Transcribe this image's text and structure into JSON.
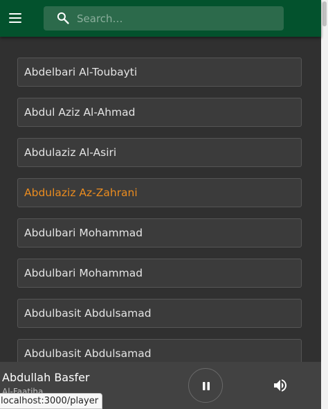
{
  "header": {
    "search": {
      "placeholder": "Search…",
      "value": ""
    }
  },
  "reciters": [
    {
      "name": "Abdelbari Al-Toubayti",
      "active": false
    },
    {
      "name": "Abdul Aziz Al-Ahmad",
      "active": false
    },
    {
      "name": "Abdulaziz Al-Asiri",
      "active": false
    },
    {
      "name": "Abdulaziz Az-Zahrani",
      "active": true
    },
    {
      "name": "Abdulbari Mohammad",
      "active": false
    },
    {
      "name": "Abdulbari Mohammad",
      "active": false
    },
    {
      "name": "Abdulbasit Abdulsamad",
      "active": false
    },
    {
      "name": "Abdulbasit Abdulsamad",
      "active": false
    }
  ],
  "player": {
    "reciter": "Abdullah Basfer",
    "surah": "Al-Faatiha"
  },
  "status_url": "localhost:3000/player",
  "colors": {
    "header_bg": "#03522d",
    "search_bg": "#2c6a4b",
    "active_text": "#eb8c1f",
    "page_bg": "#303030",
    "player_bg": "#424242"
  },
  "icons": {
    "menu": "hamburger-menu-icon",
    "search": "magnifier-icon",
    "pause": "pause-icon",
    "volume": "speaker-volume-icon"
  }
}
